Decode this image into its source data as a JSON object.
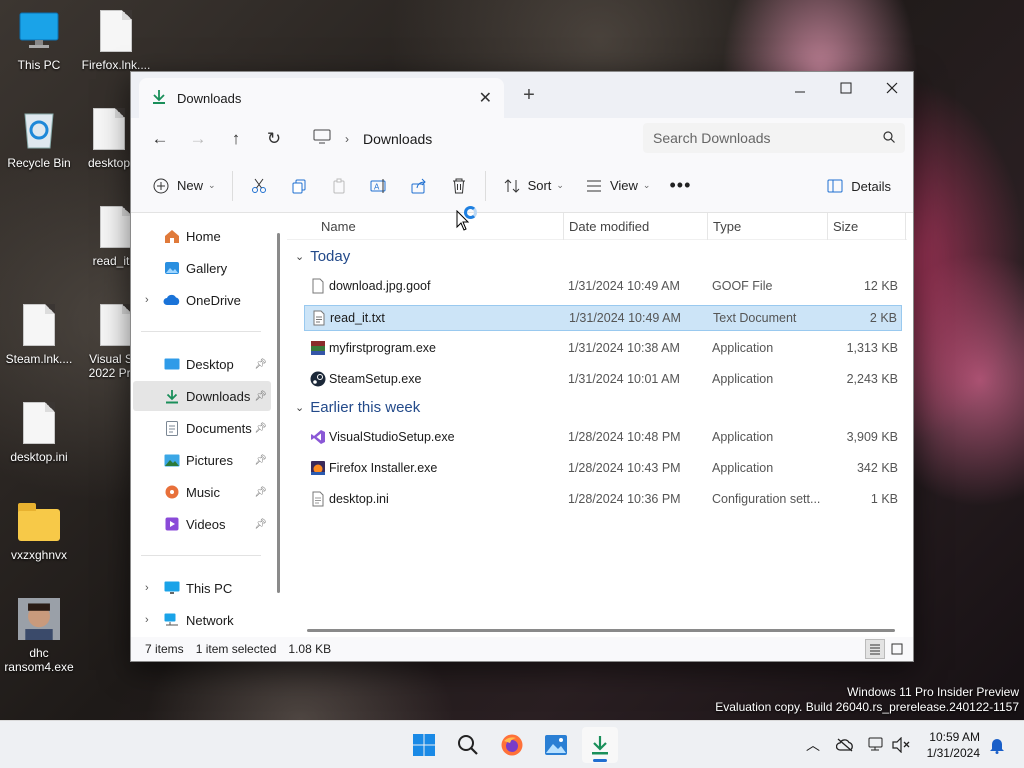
{
  "desktop": {
    "icons": [
      {
        "label": "This PC"
      },
      {
        "label": "Firefox.lnk...."
      },
      {
        "label": "Recycle Bin"
      },
      {
        "label": "desktop"
      },
      {
        "label": "read_it..."
      },
      {
        "label": "Steam.lnk...."
      },
      {
        "label": "Visual Stu 2022 Prev"
      },
      {
        "label": "desktop.ini"
      },
      {
        "label": "vxzxghnvx"
      },
      {
        "label": "dhc ransom4.exe"
      }
    ]
  },
  "window": {
    "tab_title": "Downloads",
    "new_tab_symbol": "+",
    "breadcrumb": "Downloads",
    "search_placeholder": "Search Downloads",
    "toolbar": {
      "new_label": "New",
      "sort_label": "Sort",
      "view_label": "View",
      "details_label": "Details"
    },
    "nav": {
      "items": [
        {
          "label": "Home"
        },
        {
          "label": "Gallery"
        },
        {
          "label": "OneDrive"
        },
        {
          "label": "Desktop"
        },
        {
          "label": "Downloads"
        },
        {
          "label": "Documents"
        },
        {
          "label": "Pictures"
        },
        {
          "label": "Music"
        },
        {
          "label": "Videos"
        },
        {
          "label": "This PC"
        },
        {
          "label": "Network"
        }
      ]
    },
    "columns": {
      "name": "Name",
      "date": "Date modified",
      "type": "Type",
      "size": "Size"
    },
    "groups": [
      {
        "title": "Today",
        "files": [
          {
            "name": "download.jpg.goof",
            "date": "1/31/2024 10:49 AM",
            "type": "GOOF File",
            "size": "12 KB",
            "icon": "blank-file-icon"
          },
          {
            "name": "read_it.txt",
            "date": "1/31/2024 10:49 AM",
            "type": "Text Document",
            "size": "2 KB",
            "icon": "text-file-icon",
            "selected": true
          },
          {
            "name": "myfirstprogram.exe",
            "date": "1/31/2024 10:38 AM",
            "type": "Application",
            "size": "1,313 KB",
            "icon": "archive-app-icon"
          },
          {
            "name": "SteamSetup.exe",
            "date": "1/31/2024 10:01 AM",
            "type": "Application",
            "size": "2,243 KB",
            "icon": "steam-icon"
          }
        ]
      },
      {
        "title": "Earlier this week",
        "files": [
          {
            "name": "VisualStudioSetup.exe",
            "date": "1/28/2024 10:48 PM",
            "type": "Application",
            "size": "3,909 KB",
            "icon": "visual-studio-icon"
          },
          {
            "name": "Firefox Installer.exe",
            "date": "1/28/2024 10:43 PM",
            "type": "Application",
            "size": "342 KB",
            "icon": "firefox-installer-icon"
          },
          {
            "name": "desktop.ini",
            "date": "1/28/2024 10:36 PM",
            "type": "Configuration sett...",
            "size": "1 KB",
            "icon": "config-file-icon"
          }
        ]
      }
    ],
    "status": {
      "count": "7 items",
      "selected": "1 item selected",
      "size": "1.08 KB"
    }
  },
  "watermark": {
    "line1": "Windows 11 Pro Insider Preview",
    "line2": "Evaluation copy. Build 26040.rs_prerelease.240122-1157"
  },
  "taskbar": {
    "time": "10:59 AM",
    "date": "1/31/2024"
  },
  "colors": {
    "accent": "#1f6fd1",
    "selection": "#cce4f7",
    "group_heading": "#234a8a"
  }
}
